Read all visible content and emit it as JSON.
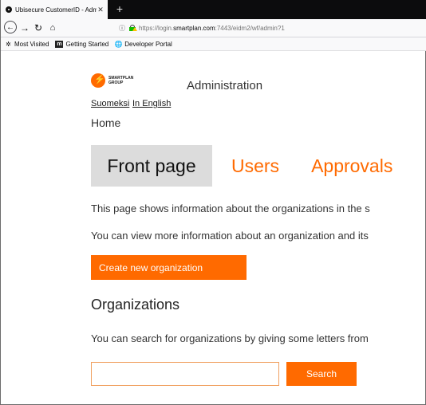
{
  "browser": {
    "tab_title": "Ubisecure CustomerID - Admin",
    "close_glyph": "✕",
    "new_tab_glyph": "+",
    "url_prefix": "https://login.",
    "url_host": "smartplan.com",
    "url_rest": ":7443/eidm2/wf/admin?1",
    "bookmarks": [
      "Most Visited",
      "Getting Started",
      "Developer Portal"
    ]
  },
  "page": {
    "logo_line1": "SMARTPLAN",
    "logo_line2": "GROUP",
    "title": "Administration",
    "lang_fi": "Suomeksi",
    "lang_en": "In English",
    "breadcrumb": "Home",
    "tabs": [
      "Front page",
      "Users",
      "Approvals"
    ],
    "intro1": "This page shows information about the organizations in the s",
    "intro2": "You can view more information about an organization and its",
    "create_button": "Create new organization",
    "orgs_heading": "Organizations",
    "search_help": "You can search for organizations by giving some letters from",
    "search_value": "",
    "search_button": "Search"
  },
  "colors": {
    "accent": "#ff6a00",
    "active_tab_bg": "#dcdcdc"
  }
}
